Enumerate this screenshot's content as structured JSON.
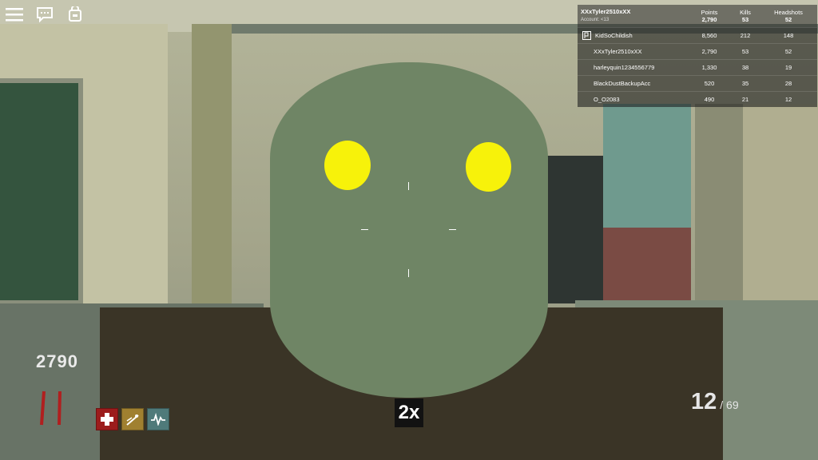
{
  "leaderboard": {
    "player": {
      "name": "XXxTyler2510xXX",
      "account": "Account: <13"
    },
    "headers": {
      "points": "Points",
      "kills": "Kills",
      "headshots": "Headshots"
    },
    "player_stats": {
      "points": "2,790",
      "kills": "53",
      "headshots": "52"
    },
    "rows": [
      {
        "name": "KidSoChildish",
        "points": "8,560",
        "kills": "212",
        "headshots": "148"
      },
      {
        "name": "XXxTyler2510xXX",
        "points": "2,790",
        "kills": "53",
        "headshots": "52"
      },
      {
        "name": "harleyquin1234556779",
        "points": "1,330",
        "kills": "38",
        "headshots": "19"
      },
      {
        "name": "BlackDustBackupAcc",
        "points": "520",
        "kills": "35",
        "headshots": "28"
      },
      {
        "name": "O_O2083",
        "points": "490",
        "kills": "21",
        "headshots": "12"
      }
    ]
  },
  "hud": {
    "points": "2790",
    "zoom": "2x",
    "ammo_mag": "12",
    "ammo_reserve": "/ 69"
  },
  "icons": {
    "menu": "hamburger-icon",
    "chat": "chat-icon",
    "backpack": "backpack-icon",
    "perk_health": "medic-cross-icon",
    "perk_speed": "speed-icon",
    "perk_stamina": "pulse-icon"
  },
  "colors": {
    "zombie_head": "#6f8565",
    "zombie_eyes": "#f7f20a",
    "health_bar": "#b01f1f",
    "perk_red": "#9c1c1c",
    "perk_gold": "#a08030",
    "perk_teal": "#4f7a7a"
  }
}
